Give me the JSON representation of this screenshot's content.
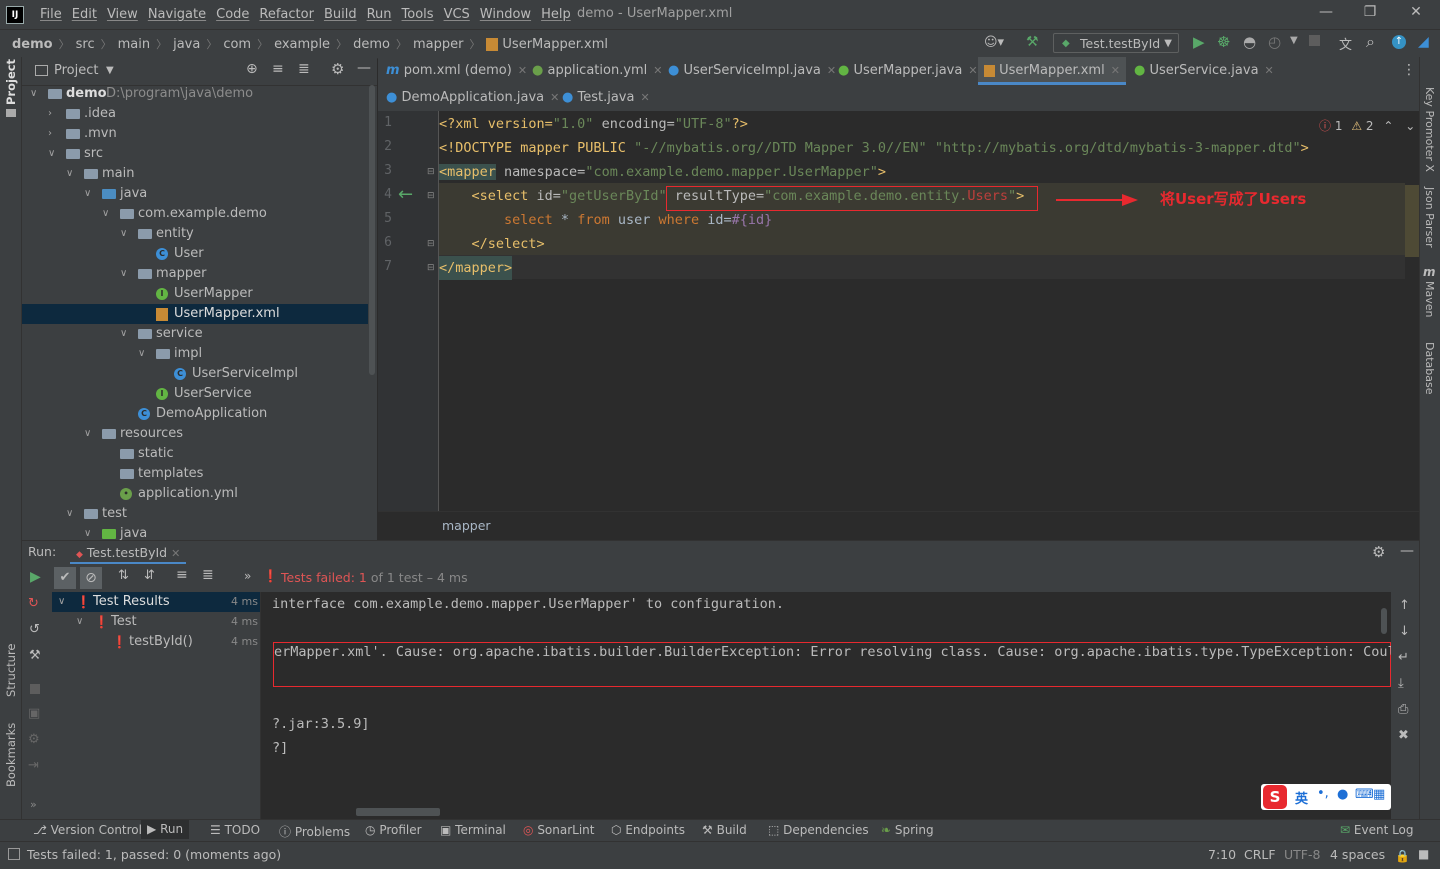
{
  "menubar": {
    "app_logo": "IJ",
    "items": [
      "File",
      "Edit",
      "View",
      "Navigate",
      "Code",
      "Refactor",
      "Build",
      "Run",
      "Tools",
      "VCS",
      "Window",
      "Help"
    ],
    "window_title": "demo - UserMapper.xml"
  },
  "navbar": {
    "crumbs": [
      "demo",
      "src",
      "main",
      "java",
      "com",
      "example",
      "demo",
      "mapper",
      "UserMapper.xml"
    ],
    "run_config": "Test.testById"
  },
  "leftstrip": {
    "project": "Project",
    "structure": "Structure",
    "bookmarks": "Bookmarks"
  },
  "rightstrip": {
    "key_promoter": "Key Promoter X",
    "json_parser": "Json Parser",
    "maven": "Maven",
    "database": "Database"
  },
  "project_panel": {
    "title": "Project",
    "tree": [
      {
        "label": "demo",
        "path": "D:\\program\\java\\demo"
      },
      {
        "label": ".idea"
      },
      {
        "label": ".mvn"
      },
      {
        "label": "src"
      },
      {
        "label": "main"
      },
      {
        "label": "java"
      },
      {
        "label": "com.example.demo"
      },
      {
        "label": "entity"
      },
      {
        "label": "User"
      },
      {
        "label": "mapper"
      },
      {
        "label": "UserMapper"
      },
      {
        "label": "UserMapper.xml"
      },
      {
        "label": "service"
      },
      {
        "label": "impl"
      },
      {
        "label": "UserServiceImpl"
      },
      {
        "label": "UserService"
      },
      {
        "label": "DemoApplication"
      },
      {
        "label": "resources"
      },
      {
        "label": "static"
      },
      {
        "label": "templates"
      },
      {
        "label": "application.yml"
      },
      {
        "label": "test"
      },
      {
        "label": "java"
      }
    ]
  },
  "editor": {
    "tabs_row1": [
      "pom.xml (demo)",
      "application.yml",
      "UserServiceImpl.java",
      "UserMapper.java",
      "UserMapper.xml",
      "UserService.java"
    ],
    "tabs_row2": [
      "DemoApplication.java",
      "Test.java"
    ],
    "inspections": {
      "errors": "1",
      "warnings": "2"
    },
    "line_numbers": [
      "1",
      "2",
      "3",
      "4",
      "5",
      "6",
      "7"
    ],
    "code": {
      "l1_a": "<?xml version=",
      "l1_b": "\"1.0\"",
      "l1_c": " encoding=",
      "l1_d": "\"UTF-8\"",
      "l1_e": "?>",
      "l2_a": "<!DOCTYPE mapper PUBLIC ",
      "l2_b": "\"-//mybatis.org//DTD Mapper 3.0//EN\"",
      "l2_c": " ",
      "l2_d": "\"http://mybatis.org/dtd/mybatis-3-mapper.dtd\"",
      "l2_e": ">",
      "l3_a": "<mapper",
      "l3_b": " namespace=",
      "l3_c": "\"com.example.demo.mapper.UserMapper\"",
      "l3_d": ">",
      "l4_a": "    <select",
      "l4_b": " id=",
      "l4_c": "\"getUserById\"",
      "l4_d": " resultType=",
      "l4_e": "\"com.example.demo.entity.",
      "l4_f": "Users",
      "l4_g": "\"",
      "l4_h": ">",
      "l5_a": "        select ",
      "l5_b": "* ",
      "l5_c": "from ",
      "l5_d": "user ",
      "l5_e": "where ",
      "l5_f": "id=",
      "l5_g": "#{id}",
      "l6": "    </select>",
      "l7": "</mapper>"
    },
    "annotation_text": "将User写成了Users",
    "breadcrumb": "mapper"
  },
  "run_panel": {
    "label": "Run:",
    "tab": "Test.testById",
    "status_failed": "Tests failed: 1",
    "status_rest": " of 1 test – 4 ms",
    "tree": [
      {
        "label": "Test Results",
        "time": "4 ms"
      },
      {
        "label": "Test",
        "time": "4 ms"
      },
      {
        "label": "testById()",
        "time": "4 ms"
      }
    ],
    "console": [
      "interface com.example.demo.mapper.UserMapper' to configuration.",
      "erMapper.xml'. Cause: org.apache.ibatis.builder.BuilderException: Error resolving class. Cause: org.apache.ibatis.type.TypeException: Could",
      "?.jar:3.5.9]",
      "?]"
    ]
  },
  "bottom_tools": [
    "Version Control",
    "Run",
    "TODO",
    "Problems",
    "Profiler",
    "Terminal",
    "SonarLint",
    "Endpoints",
    "Build",
    "Dependencies",
    "Spring"
  ],
  "event_log": "Event Log",
  "ime": {
    "lang": "英"
  },
  "statusbar": {
    "message": "Tests failed: 1, passed: 0 (moments ago)",
    "position": "7:10",
    "line_sep": "CRLF",
    "encoding": "UTF-8",
    "indent": "4 spaces"
  },
  "colors": {
    "bg": "#2b2b2b",
    "panel": "#3c3f41",
    "accent": "#4a88c7",
    "annotation": "#e8292f",
    "xml_tag": "#e8bf6a",
    "xml_attr": "#bababa",
    "xml_string": "#6a8759",
    "sql_keyword": "#cc7832"
  }
}
